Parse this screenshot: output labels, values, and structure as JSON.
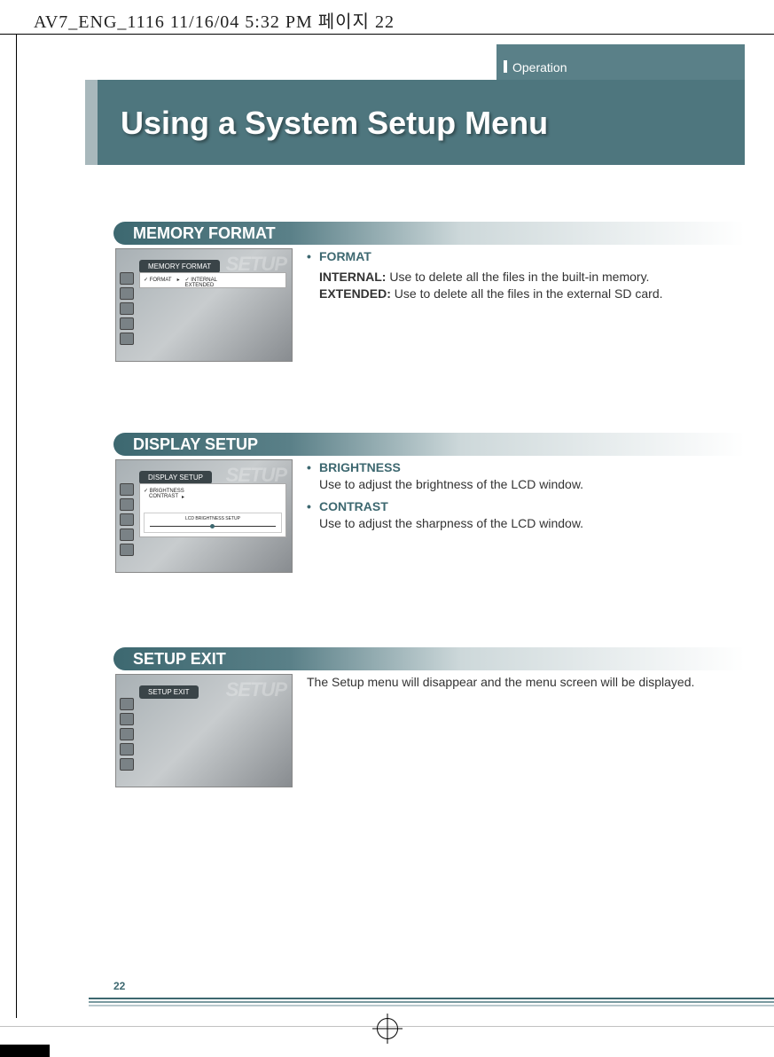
{
  "header_stamp": "AV7_ENG_1116  11/16/04  5:32 PM 페이지 22",
  "tab_label": "Operation",
  "title": "Using a System Setup Menu",
  "page_number": "22",
  "setup_bg_text": "SETUP",
  "sections": {
    "memory": {
      "heading": "MEMORY FORMAT",
      "thumb_tab": "MEMORY FORMAT",
      "thumb_col1": "✓ FORMAT",
      "thumb_col2a": "✓ INTERNAL",
      "thumb_col2b": "EXTENDED",
      "bullet_label": "FORMAT",
      "line1_bold": "INTERNAL:",
      "line1_rest": " Use to delete all the files in the built-in memory.",
      "line2_bold": "EXTENDED:",
      "line2_rest": " Use to delete all the files in the external SD card."
    },
    "display": {
      "heading": "DISPLAY SETUP",
      "thumb_tab": "DISPLAY SETUP",
      "thumb_row1": "✓ BRIGHTNESS",
      "thumb_row2": "CONTRAST",
      "slider_label": "LCD BRIGHTNESS SETUP",
      "b1_label": "BRIGHTNESS",
      "b1_text": "Use to adjust the brightness of the LCD window.",
      "b2_label": "CONTRAST",
      "b2_text": "Use to adjust the sharpness of the LCD window."
    },
    "exit": {
      "heading": "SETUP EXIT",
      "thumb_tab": "SETUP EXIT",
      "text": "The Setup menu will disappear and the menu screen will be displayed."
    }
  }
}
